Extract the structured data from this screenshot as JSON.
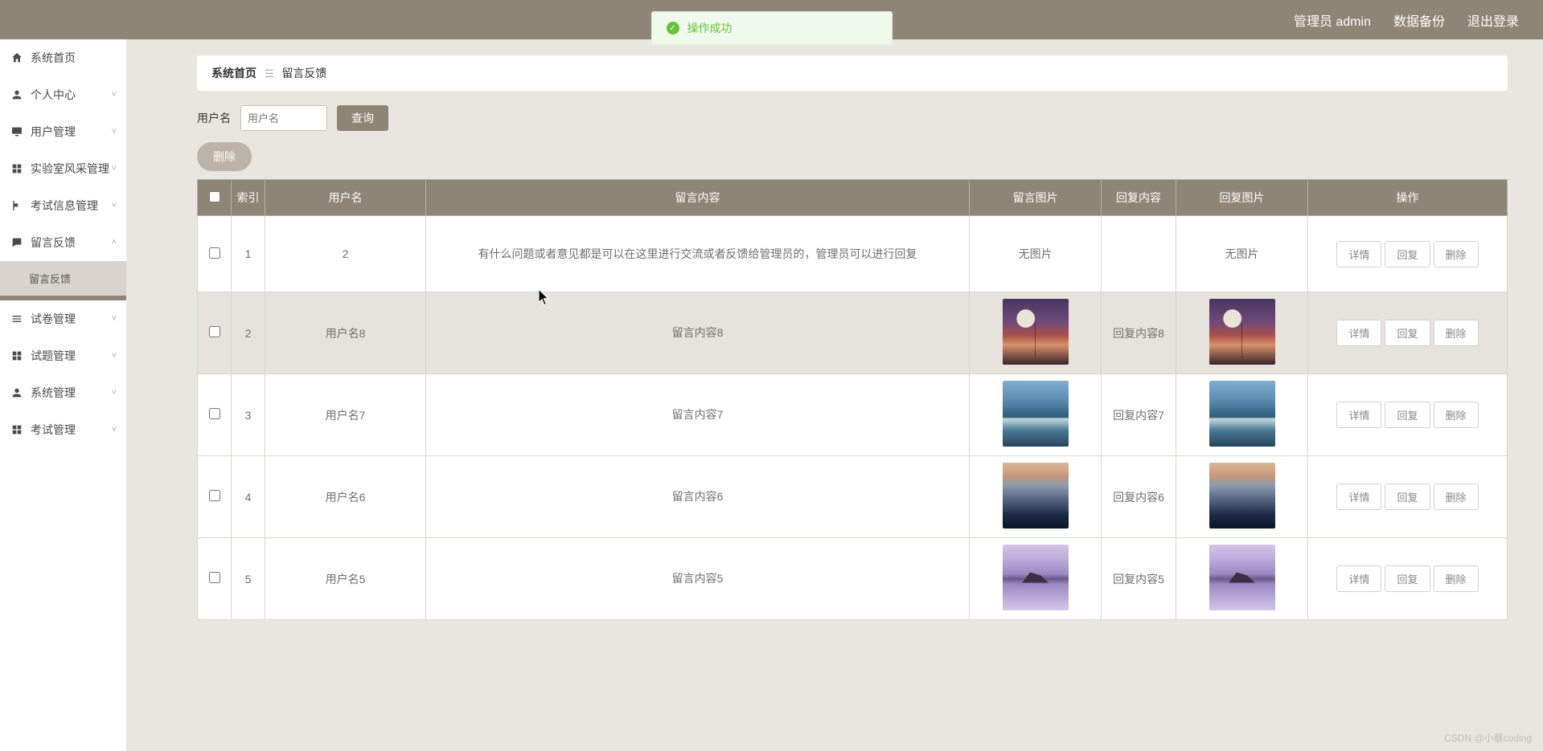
{
  "toast": {
    "message": "操作成功"
  },
  "header": {
    "admin_label": "管理员 admin",
    "backup_label": "数据备份",
    "logout_label": "退出登录"
  },
  "sidebar": {
    "items": [
      {
        "icon": "home",
        "label": "系统首页",
        "expandable": false
      },
      {
        "icon": "person",
        "label": "个人中心",
        "expandable": true
      },
      {
        "icon": "monitor",
        "label": "用户管理",
        "expandable": true
      },
      {
        "icon": "grid",
        "label": "实验室风采管理",
        "expandable": true
      },
      {
        "icon": "flag",
        "label": "考试信息管理",
        "expandable": true
      },
      {
        "icon": "bubble",
        "label": "留言反馈",
        "expandable": true,
        "open": true,
        "children": [
          {
            "label": "留言反馈",
            "active": true
          }
        ]
      },
      {
        "icon": "list",
        "label": "试卷管理",
        "expandable": true
      },
      {
        "icon": "grid",
        "label": "试题管理",
        "expandable": true
      },
      {
        "icon": "person",
        "label": "系统管理",
        "expandable": true
      },
      {
        "icon": "grid",
        "label": "考试管理",
        "expandable": true
      }
    ]
  },
  "breadcrumb": {
    "home": "系统首页",
    "current": "留言反馈"
  },
  "search": {
    "label": "用户名",
    "placeholder": "用户名",
    "query_btn": "查询",
    "delete_btn": "删除"
  },
  "table": {
    "columns": [
      "",
      "索引",
      "用户名",
      "留言内容",
      "留言图片",
      "回复内容",
      "回复图片",
      "操作"
    ],
    "actions": {
      "detail": "详情",
      "reply": "回复",
      "del": "删除"
    },
    "no_image": "无图片",
    "rows": [
      {
        "idx": "1",
        "user": "2",
        "content": "有什么问题或者意见都是可以在这里进行交流或者反馈给管理员的，管理员可以进行回复",
        "img": null,
        "reply": "",
        "reply_img": null,
        "hovered": false
      },
      {
        "idx": "2",
        "user": "用户名8",
        "content": "留言内容8",
        "img": "moon",
        "reply": "回复内容8",
        "reply_img": "moon",
        "hovered": true
      },
      {
        "idx": "3",
        "user": "用户名7",
        "content": "留言内容7",
        "img": "water",
        "reply": "回复内容7",
        "reply_img": "water",
        "hovered": false
      },
      {
        "idx": "4",
        "user": "用户名6",
        "content": "留言内容6",
        "img": "mnt",
        "reply": "回复内容6",
        "reply_img": "mnt",
        "hovered": false
      },
      {
        "idx": "5",
        "user": "用户名5",
        "content": "留言内容5",
        "img": "lake",
        "reply": "回复内容5",
        "reply_img": "lake",
        "hovered": false
      }
    ]
  },
  "watermark": "CSDN @小蔡coding"
}
